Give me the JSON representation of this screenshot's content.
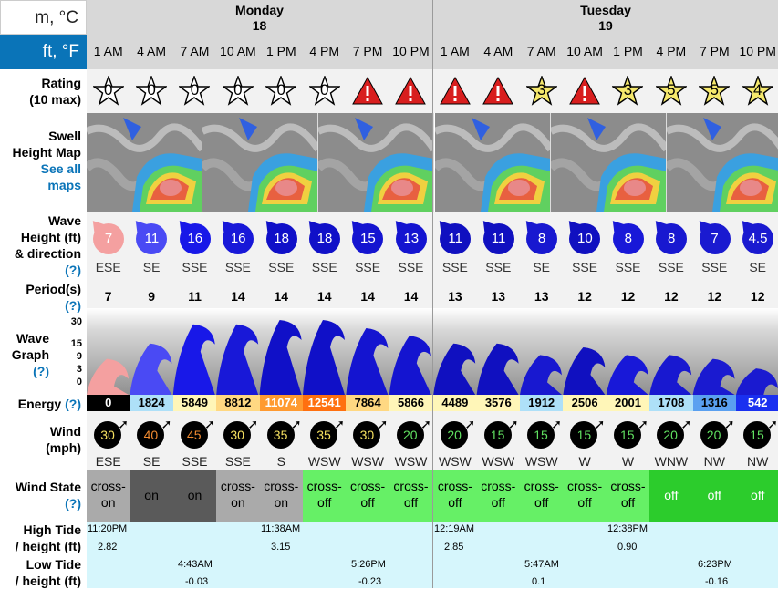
{
  "units": {
    "metric": "m, °C",
    "imperial": "ft, °F"
  },
  "days": [
    {
      "name": "Monday",
      "date": "18"
    },
    {
      "name": "Tuesday",
      "date": "19"
    }
  ],
  "times": [
    "1 AM",
    "4 AM",
    "7 AM",
    "10 AM",
    "1 PM",
    "4 PM",
    "7 PM",
    "10 PM",
    "1 AM",
    "4 AM",
    "7 AM",
    "10 AM",
    "1 PM",
    "4 PM",
    "7 PM",
    "10 PM"
  ],
  "labels": {
    "rating": "Rating",
    "rating_sub": "(10 max)",
    "swell_map": "Swell",
    "swell_map2": "Height Map",
    "see_all": "See all",
    "see_all2": "maps",
    "wave_height": "Wave",
    "wave_height2": "Height (ft)",
    "wave_height3": "& direction",
    "period": "Period(s)",
    "wave_graph": "Wave",
    "wave_graph2": "Graph",
    "energy": "Energy",
    "wind": "Wind",
    "wind2": "(mph)",
    "wind_state": "Wind State",
    "high_tide": "High Tide",
    "high_tide2": "/ height (ft)",
    "low_tide": "Low Tide",
    "low_tide2": "/ height (ft)",
    "help": "(?)"
  },
  "ratings": [
    "0",
    "0",
    "0",
    "0",
    "0",
    "0",
    "!",
    "!",
    "!",
    "!",
    "3",
    "!",
    "3",
    "5",
    "5",
    "4"
  ],
  "rating_colors": {
    "star_empty": "#ffffff",
    "star_full": "#f5e86c",
    "warning": "#d81e1e"
  },
  "wave_heights": [
    "7",
    "11",
    "16",
    "16",
    "18",
    "18",
    "15",
    "13",
    "11",
    "11",
    "8",
    "10",
    "8",
    "8",
    "7",
    "4.5"
  ],
  "wave_colors": [
    "#f4a0a0",
    "#4a4af4",
    "#1818e8",
    "#1818d8",
    "#1010c8",
    "#1010c8",
    "#1414d0",
    "#1414d0",
    "#1010c0",
    "#1010c0",
    "#1818d0",
    "#1010c0",
    "#1818d8",
    "#1818d0",
    "#1a1ad0",
    "#1a1ad0"
  ],
  "wave_dirs": [
    "ESE",
    "SE",
    "SSE",
    "SSE",
    "SSE",
    "SSE",
    "SSE",
    "SSE",
    "SSE",
    "SSE",
    "SE",
    "SSE",
    "SSE",
    "SSE",
    "SSE",
    "SE"
  ],
  "periods": [
    "7",
    "9",
    "11",
    "14",
    "14",
    "14",
    "14",
    "14",
    "13",
    "13",
    "13",
    "12",
    "12",
    "12",
    "12",
    "12"
  ],
  "graph_axis": [
    "30",
    "15",
    "9",
    "3",
    "0"
  ],
  "energy": [
    "0",
    "1824",
    "5849",
    "8812",
    "11074",
    "12541",
    "7864",
    "5866",
    "4489",
    "3576",
    "1912",
    "2506",
    "2001",
    "1708",
    "1316",
    "542"
  ],
  "energy_colors": [
    "#000000",
    "#aee0f8",
    "#fff6b8",
    "#ffd882",
    "#ff9a30",
    "#ff7010",
    "#ffd882",
    "#fff6b8",
    "#fff6b8",
    "#fff6b8",
    "#aee0f8",
    "#fff6b8",
    "#fff6b8",
    "#aee0f8",
    "#5aa0f0",
    "#1a30f0"
  ],
  "wind_speeds": [
    "30",
    "40",
    "45",
    "30",
    "35",
    "35",
    "30",
    "20",
    "20",
    "15",
    "15",
    "15",
    "15",
    "20",
    "20",
    "15"
  ],
  "wind_colors": [
    "#f5e060",
    "#f08a30",
    "#f08a30",
    "#f5e060",
    "#f5e060",
    "#f5e060",
    "#f5e060",
    "#60e060",
    "#60e060",
    "#60e060",
    "#60e060",
    "#60e060",
    "#60e060",
    "#60e060",
    "#60e060",
    "#60e060"
  ],
  "wind_dirs": [
    "ESE",
    "SE",
    "SSE",
    "SSE",
    "S",
    "WSW",
    "WSW",
    "WSW",
    "WSW",
    "WSW",
    "WSW",
    "W",
    "W",
    "WNW",
    "NW",
    "NW"
  ],
  "wind_state": [
    "cross-on",
    "on",
    "on",
    "cross-on",
    "cross-on",
    "cross-off",
    "cross-off",
    "cross-off",
    "cross-off",
    "cross-off",
    "cross-off",
    "cross-off",
    "cross-off",
    "off",
    "off",
    "off"
  ],
  "high_tides": [
    {
      "time": "11:20PM",
      "height": "2.82"
    },
    {
      "time": "11:38AM",
      "height": "3.15"
    },
    {
      "time": "12:19AM",
      "height": "2.85"
    },
    {
      "time": "12:38PM",
      "height": "0.90"
    }
  ],
  "low_tides": [
    {
      "time": "4:43AM",
      "height": "-0.03"
    },
    {
      "time": "5:26PM",
      "height": "-0.23"
    },
    {
      "time": "5:47AM",
      "height": "0.1"
    },
    {
      "time": "6:23PM",
      "height": "-0.16"
    }
  ]
}
